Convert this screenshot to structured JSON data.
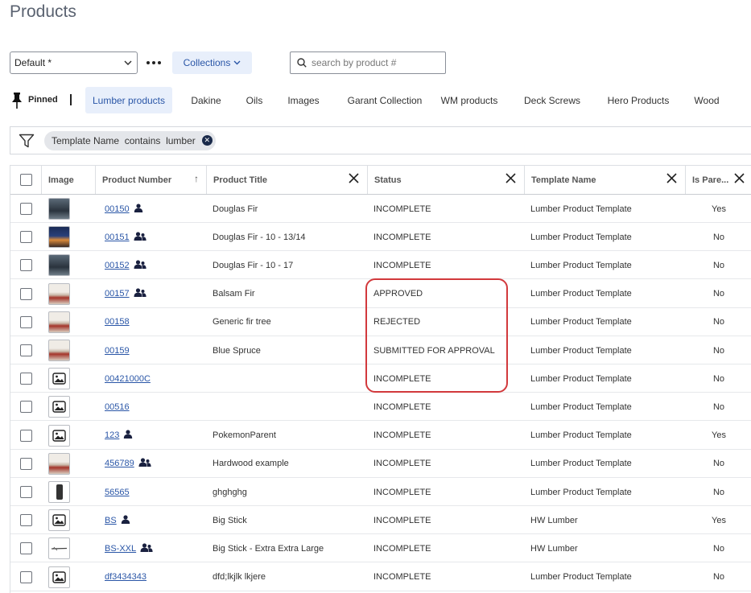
{
  "page": {
    "title": "Products"
  },
  "toolbar": {
    "view_select": "Default *",
    "collections_label": "Collections",
    "search_placeholder": "search by product #"
  },
  "pinned": {
    "label": "Pinned",
    "tabs": [
      {
        "label": "Lumber products",
        "active": true
      },
      {
        "label": "Dakine"
      },
      {
        "label": "Oils"
      },
      {
        "label": "Images"
      },
      {
        "label": "Garant Collection"
      },
      {
        "label": "WM products"
      },
      {
        "label": "Deck Screws"
      },
      {
        "label": "Hero Products"
      },
      {
        "label": "Wood"
      }
    ]
  },
  "filter": {
    "chip": "Template Name  contains  lumber"
  },
  "table": {
    "columns": {
      "image": "Image",
      "product_number": "Product Number",
      "product_title": "Product Title",
      "status": "Status",
      "template_name": "Template Name",
      "is_parent": "Is Pare..."
    },
    "sort_indicator": "↑",
    "rows": [
      {
        "thumb": "photo-grey",
        "number": "00150",
        "user_icon": "single",
        "title": "Douglas Fir",
        "status": "INCOMPLETE",
        "template": "Lumber Product Template",
        "is_parent": "Yes"
      },
      {
        "thumb": "photo-night",
        "number": "00151",
        "user_icon": "group",
        "title": "Douglas Fir - 10 - 13/14",
        "status": "INCOMPLETE",
        "template": "Lumber Product Template",
        "is_parent": "No"
      },
      {
        "thumb": "photo-grey",
        "number": "00152",
        "user_icon": "group",
        "title": "Douglas Fir - 10 - 17",
        "status": "INCOMPLETE",
        "template": "Lumber Product Template",
        "is_parent": "No"
      },
      {
        "thumb": "photo-log",
        "number": "00157",
        "user_icon": "group",
        "title": "Balsam Fir",
        "status": "APPROVED",
        "template": "Lumber Product Template",
        "is_parent": "No"
      },
      {
        "thumb": "photo-log",
        "number": "00158",
        "user_icon": "none",
        "title": "Generic fir tree",
        "status": "REJECTED",
        "template": "Lumber Product Template",
        "is_parent": "No"
      },
      {
        "thumb": "photo-log",
        "number": "00159",
        "user_icon": "none",
        "title": "Blue Spruce",
        "status": "SUBMITTED FOR APPROVAL",
        "template": "Lumber Product Template",
        "is_parent": "No"
      },
      {
        "thumb": "placeholder",
        "number": "00421000C",
        "user_icon": "none",
        "title": "",
        "status": "INCOMPLETE",
        "template": "Lumber Product Template",
        "is_parent": "No"
      },
      {
        "thumb": "placeholder",
        "number": "00516",
        "user_icon": "none",
        "title": "",
        "status": "INCOMPLETE",
        "template": "Lumber Product Template",
        "is_parent": "No"
      },
      {
        "thumb": "placeholder",
        "number": "123",
        "user_icon": "single",
        "title": "PokemonParent",
        "status": "INCOMPLETE",
        "template": "Lumber Product Template",
        "is_parent": "Yes"
      },
      {
        "thumb": "photo-log",
        "number": "456789",
        "user_icon": "group",
        "title": "Hardwood example",
        "status": "INCOMPLETE",
        "template": "Lumber Product Template",
        "is_parent": "No"
      },
      {
        "thumb": "phone",
        "number": "56565",
        "user_icon": "none",
        "title": "ghghghg",
        "status": "INCOMPLETE",
        "template": "Lumber Product Template",
        "is_parent": "No"
      },
      {
        "thumb": "placeholder",
        "number": "BS",
        "user_icon": "single",
        "title": "Big Stick",
        "status": "INCOMPLETE",
        "template": "HW Lumber",
        "is_parent": "Yes"
      },
      {
        "thumb": "stick",
        "number": "BS-XXL",
        "user_icon": "group",
        "title": "Big Stick - Extra Extra Large",
        "status": "INCOMPLETE",
        "template": "HW Lumber",
        "is_parent": "No"
      },
      {
        "thumb": "placeholder",
        "number": "df3434343",
        "user_icon": "none",
        "title": "dfd;lkjlk lkjere",
        "status": "INCOMPLETE",
        "template": "Lumber Product Template",
        "is_parent": "No"
      }
    ]
  },
  "colors": {
    "accent": "#2a56a7",
    "accent_bg": "#e8effb",
    "highlight": "#d2393c"
  }
}
